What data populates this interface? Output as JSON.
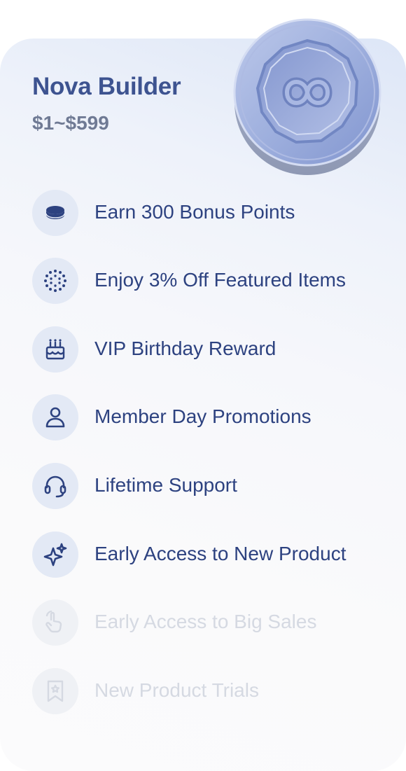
{
  "tier": {
    "name": "Nova Builder",
    "price_range": "$1~$599",
    "badge_icon": "infinity-coin-icon"
  },
  "colors": {
    "accent": "#3d5390",
    "text": "#2d4280",
    "muted": "#6f7a94",
    "icon_bg": "#e3e9f5",
    "locked_text": "#d5d9e2"
  },
  "benefits": [
    {
      "label": "Earn 300 Bonus Points",
      "icon": "coin-icon",
      "unlocked": true
    },
    {
      "label": "Enjoy 3% Off Featured Items",
      "icon": "discount-dots-icon",
      "unlocked": true
    },
    {
      "label": "VIP Birthday Reward",
      "icon": "cake-icon",
      "unlocked": true
    },
    {
      "label": "Member Day Promotions",
      "icon": "person-icon",
      "unlocked": true
    },
    {
      "label": "Lifetime Support",
      "icon": "headset-icon",
      "unlocked": true
    },
    {
      "label": "Early Access to New Product",
      "icon": "sparkle-icon",
      "unlocked": true
    },
    {
      "label": "Early Access to Big Sales",
      "icon": "tap-hand-icon",
      "unlocked": false
    },
    {
      "label": "New Product Trials",
      "icon": "bookmark-icon",
      "unlocked": false
    }
  ]
}
